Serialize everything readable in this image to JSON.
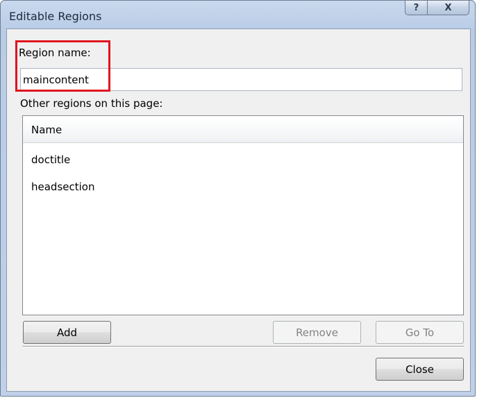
{
  "window": {
    "title": "Editable Regions",
    "help_label": "?",
    "close_label": "X"
  },
  "region_name": {
    "label": "Region name:",
    "value": "maincontent"
  },
  "other_regions": {
    "label": "Other regions on this page:",
    "column_header": "Name",
    "items": [
      "doctitle",
      "headsection"
    ]
  },
  "buttons": {
    "add": "Add",
    "remove": "Remove",
    "goto": "Go To",
    "close": "Close"
  },
  "colors": {
    "highlight": "#e0141e"
  }
}
